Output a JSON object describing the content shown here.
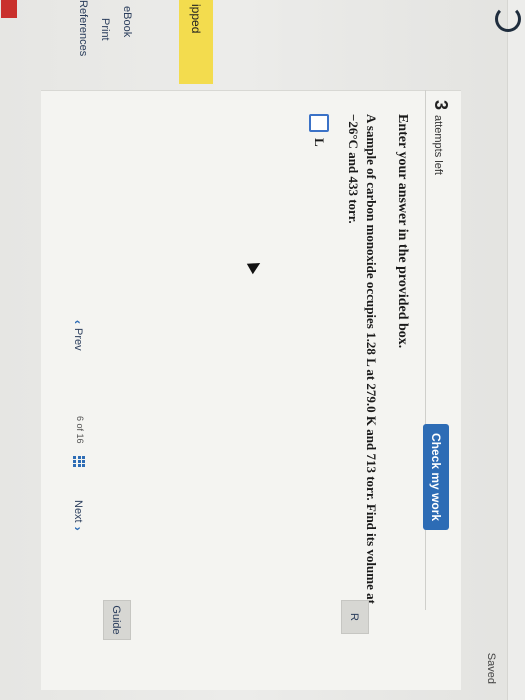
{
  "header": {
    "saved_status": "Saved"
  },
  "left_rail": {
    "skipped_label": "ipped",
    "links": [
      "eBook",
      "Print",
      "References"
    ]
  },
  "question_panel": {
    "attempts_number": "3",
    "attempts_text": "attempts left",
    "check_button_label": "Check my work",
    "instruction": "Enter your answer in the provided box.",
    "question_text": "A sample of carbon monoxide occupies 1.28 L at 279.0 K and 713 torr. Find its volume at −26°C and 433 torr.",
    "unit_label": "L"
  },
  "navigation": {
    "prev_label": "Prev",
    "page_indicator": "6 of 16",
    "next_label": "Next"
  },
  "right_tabs": {
    "top_tab": "R",
    "bottom_tab": "Guide"
  },
  "colors": {
    "accent": "#2d6cb5",
    "skipped": "#f3dc4e",
    "brand": "#c9302c"
  }
}
